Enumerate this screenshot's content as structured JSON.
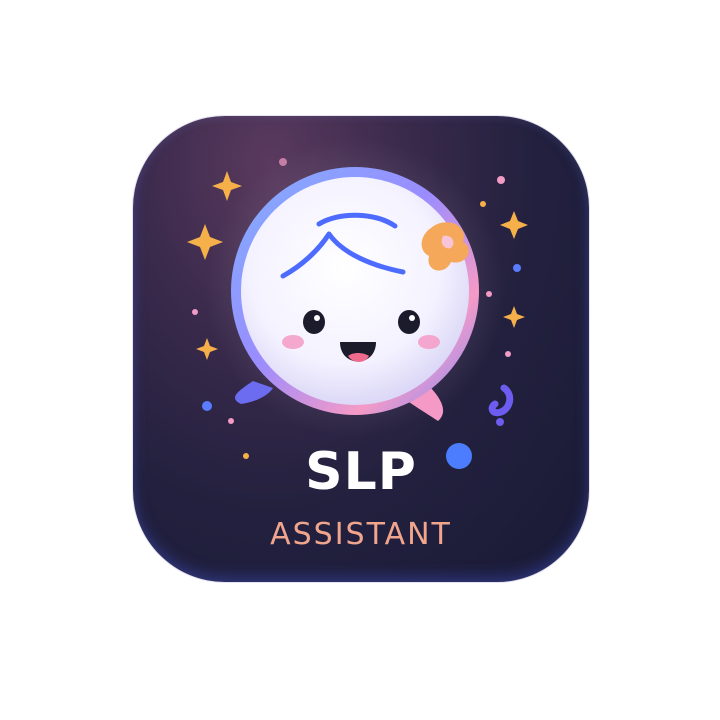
{
  "logo": {
    "title": "SLP",
    "subtitle": "ASSISTANT",
    "icon": "smiling-chat-bubble-mascot",
    "colors": {
      "background": "#1c1c3a",
      "title": "#ffffff",
      "subtitle": "#f0a58c",
      "accent_blue": "#5a7cff",
      "accent_pink": "#f29bc4",
      "accent_orange": "#f5b04a"
    }
  }
}
